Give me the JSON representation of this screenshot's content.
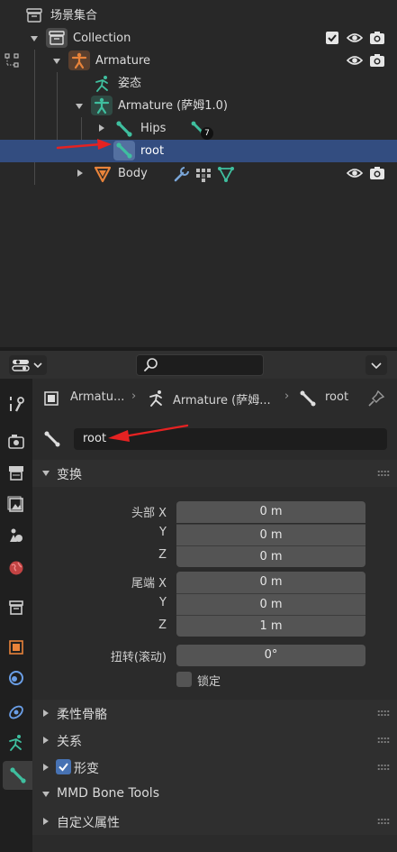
{
  "outliner": {
    "scene_collection": "场景集合",
    "collection": "Collection",
    "armature_object": "Armature",
    "pose": "姿态",
    "armature_data": "Armature (萨姆1.0)",
    "hips": "Hips",
    "hips_child_count": "7",
    "root": "root",
    "body": "Body"
  },
  "properties": {
    "breadcrumb": {
      "object": "Armatu...",
      "armature": "Armature (萨姆...",
      "bone": "root"
    },
    "bone_name": "root",
    "transform": {
      "title": "变换",
      "head_label": "头部 X",
      "tail_label": "尾端 X",
      "y_label": "Y",
      "z_label": "Z",
      "head_x": "0 m",
      "head_y": "0 m",
      "head_z": "0 m",
      "tail_x": "0 m",
      "tail_y": "0 m",
      "tail_z": "1 m",
      "roll_label": "扭转(滚动)",
      "roll": "0°",
      "lock_label": "锁定"
    },
    "panels": {
      "bendy_bones": "柔性骨骼",
      "relations": "关系",
      "deform": "形变",
      "mmd_bone_tools": "MMD Bone Tools",
      "custom_props": "自定义属性"
    }
  },
  "colors": {
    "selection": "#334d80",
    "bone_green": "#3fbf9f",
    "object_orange": "#e8833a",
    "arrow_red": "#e52222",
    "checkbox_blue": "#4772b3"
  }
}
